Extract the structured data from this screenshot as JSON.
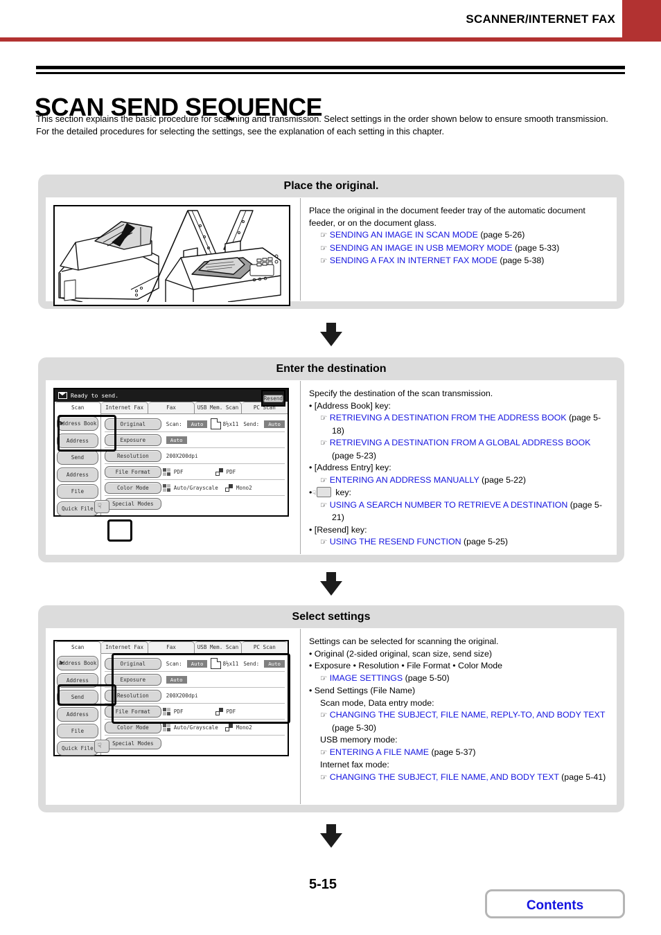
{
  "header": {
    "title": "SCANNER/INTERNET FAX",
    "accent_color": "#b23231"
  },
  "page_title": "SCAN SEND SEQUENCE",
  "intro": {
    "line1": "This section explains the basic procedure for scanning and transmission. Select settings in the order shown below to ensure smooth transmission.",
    "line2": "For the detailed procedures for selecting the settings, see the explanation of each setting in this chapter."
  },
  "steps": [
    {
      "heading": "Place the original.",
      "text": {
        "intro": "Place the original in the document feeder tray of the automatic document feeder, or on the document glass.",
        "refs": [
          {
            "link": "SENDING AN IMAGE IN SCAN MODE",
            "page": "(page 5-26)"
          },
          {
            "link": "SENDING AN IMAGE IN USB MEMORY MODE",
            "page": "(page 5-33)"
          },
          {
            "link": "SENDING A FAX IN INTERNET FAX MODE",
            "page": "(page 5-38)"
          }
        ]
      }
    },
    {
      "heading": "Enter the destination",
      "text": {
        "intro": "Specify the destination of the scan transmission.",
        "b1": "• [Address Book] key:",
        "r1a_link": "RETRIEVING A DESTINATION FROM THE ADDRESS BOOK",
        "r1a_page": "(page 5-18)",
        "r1b_link": "RETRIEVING A DESTINATION FROM A GLOBAL ADDRESS BOOK",
        "r1b_page": "(page 5-23)",
        "b2": "• [Address Entry] key:",
        "r2_link": "ENTERING AN ADDRESS MANUALLY",
        "r2_page": "(page 5-22)",
        "b3_pre": "•",
        "b3_post": "key:",
        "r3_link": "USING A SEARCH NUMBER TO RETRIEVE A DESTINATION",
        "r3_page": "(page 5-21)",
        "b4": "• [Resend] key:",
        "r4_link": "USING THE RESEND FUNCTION",
        "r4_page": "(page 5-25)"
      }
    },
    {
      "heading": "Select settings",
      "text": {
        "intro": "Settings can be selected for scanning the original.",
        "b1": "• Original (2-sided original, scan size, send size)",
        "b2": "• Exposure  • Resolution  • File Format  • Color Mode",
        "r2_link": "IMAGE SETTINGS",
        "r2_page": "(page 5-50)",
        "b3": "• Send Settings (File Name)",
        "s1": "Scan mode, Data entry mode:",
        "r3_link": "CHANGING THE SUBJECT, FILE NAME, REPLY-TO, AND BODY TEXT",
        "r3_page": "(page 5-30)",
        "s2": "USB memory mode:",
        "r4_link": "ENTERING A FILE NAME",
        "r4_page": "(page 5-37)",
        "s3": "Internet fax mode:",
        "r5_link": "CHANGING THE SUBJECT, FILE NAME, AND BODY TEXT",
        "r5_page": "(page 5-41)"
      }
    }
  ],
  "scanner_ui": {
    "status_text": "Ready to send.",
    "resend_label": "Resend",
    "tabs": [
      {
        "label": "Scan",
        "active": true
      },
      {
        "label": "Internet Fax",
        "active": false
      },
      {
        "label": "Fax",
        "active": false
      },
      {
        "label": "USB Mem. Scan",
        "active": false
      },
      {
        "label": "PC Scan",
        "active": false
      }
    ],
    "side_keys": [
      "Address Book",
      "Address Entry",
      "Send Settings",
      "Address Review",
      "File",
      "Quick File"
    ],
    "rows": {
      "original": {
        "key": "Original",
        "scan_label": "Scan:",
        "scan_value": "Auto",
        "size_value": "8½x11",
        "send_label": "Send:",
        "send_value": "Auto"
      },
      "exposure": {
        "key": "Exposure",
        "value": "Auto"
      },
      "resolution": {
        "key": "Resolution",
        "value": "200X200dpi"
      },
      "file_format": {
        "key": "File Format",
        "color_value": "PDF",
        "mono_value": "PDF"
      },
      "color_mode": {
        "key": "Color Mode",
        "color_value": "Auto/Grayscale",
        "mono_value": "Mono2"
      },
      "special_modes": {
        "key": "Special Modes"
      }
    }
  },
  "footer": {
    "page_number": "5-15",
    "contents_label": "Contents"
  }
}
